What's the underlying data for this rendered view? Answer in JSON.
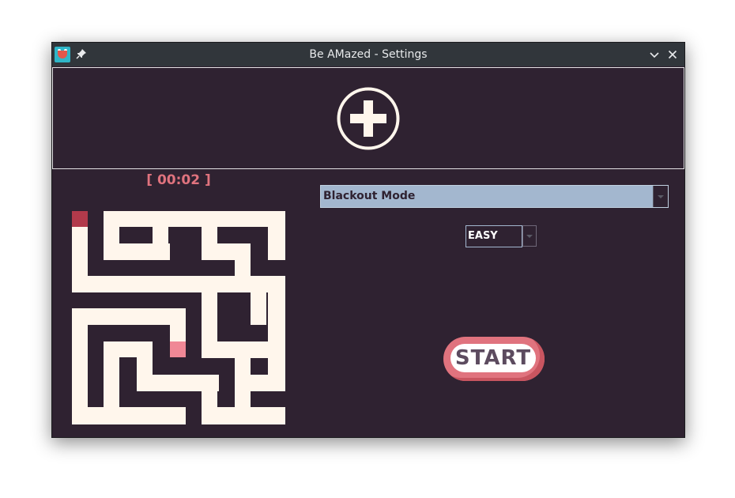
{
  "window": {
    "title": "Be AMazed - Settings"
  },
  "banner": {
    "icon": "plus-circle-icon"
  },
  "game": {
    "timer": "[ 00:02 ]"
  },
  "controls": {
    "mode_selected": "Blackout Mode",
    "difficulty_selected": "EASY",
    "start_label": "START"
  },
  "colors": {
    "window_bg": "#2f2231",
    "titlebar_bg": "#31363b",
    "maze_path": "#fff6ec",
    "accent": "#e0737e",
    "maze_start": "#b23a4b",
    "maze_goal": "#f08896",
    "select_bg": "#a3b7cf"
  }
}
